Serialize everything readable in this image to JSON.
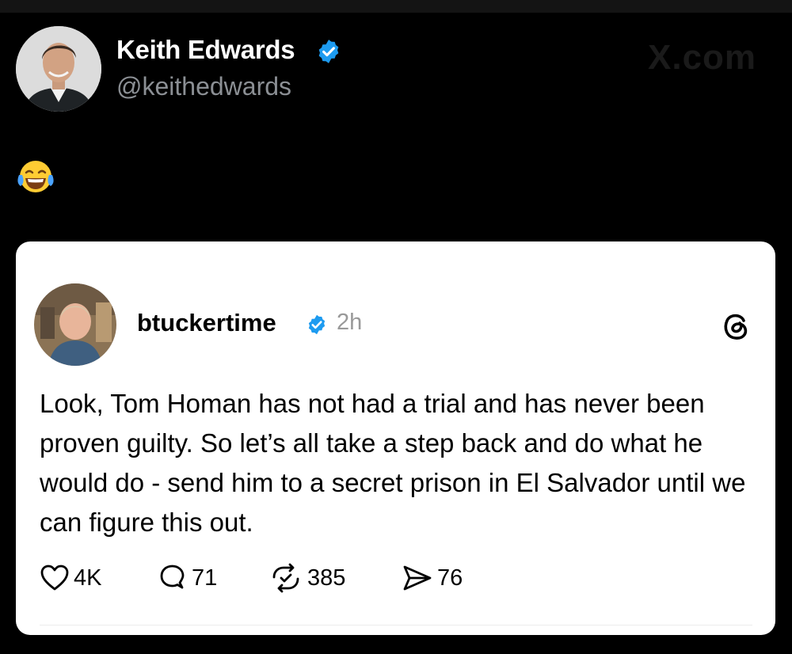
{
  "author": {
    "name": "Keith Edwards",
    "handle": "@keithedwards",
    "verified": true,
    "verified_color": "#1d9bf0",
    "avatar_icon": "profile-photo"
  },
  "watermark": "X.com",
  "post_reaction_emoji": "face-with-tears-of-joy-emoji",
  "quoted_post": {
    "platform_icon": "threads-logo-icon",
    "username": "btuckertime",
    "verified": true,
    "time": "2h",
    "text": "Look, Tom Homan has not had a trial and has never been proven guilty. So let’s all take a step back and do what he would do -  send him to a secret prison in El Salvador until we can figure this out.",
    "actions": {
      "likes": "4K",
      "replies": "71",
      "reposts": "385",
      "shares": "76"
    }
  },
  "colors": {
    "background": "#000000",
    "card": "#ffffff",
    "handle_gray": "#8b8f94",
    "time_gray": "#999999"
  }
}
